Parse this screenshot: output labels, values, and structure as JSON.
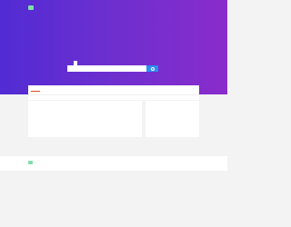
{
  "brand": {
    "name": ""
  },
  "header": {
    "nav": [
      "",
      "",
      "",
      "",
      ""
    ]
  },
  "search": {
    "tabs": [
      "",
      "",
      "",
      "",
      ""
    ],
    "active_tab": 1,
    "placeholder": "",
    "hot": ""
  },
  "panels": {
    "main_title": "",
    "sub_text": "",
    "row_left": "",
    "row_right": "",
    "left_title": "",
    "right_title": "",
    "right_items": [
      "",
      "",
      "",
      "",
      "",
      ""
    ]
  },
  "links": [
    "",
    "",
    "",
    ""
  ],
  "footer": {
    "nav": [
      "",
      "",
      "",
      ""
    ]
  },
  "colors": {
    "hero_start": "#512bd4",
    "hero_end": "#8a2ccc",
    "accent": "#e0452b",
    "search_button": "#2e8df5"
  }
}
